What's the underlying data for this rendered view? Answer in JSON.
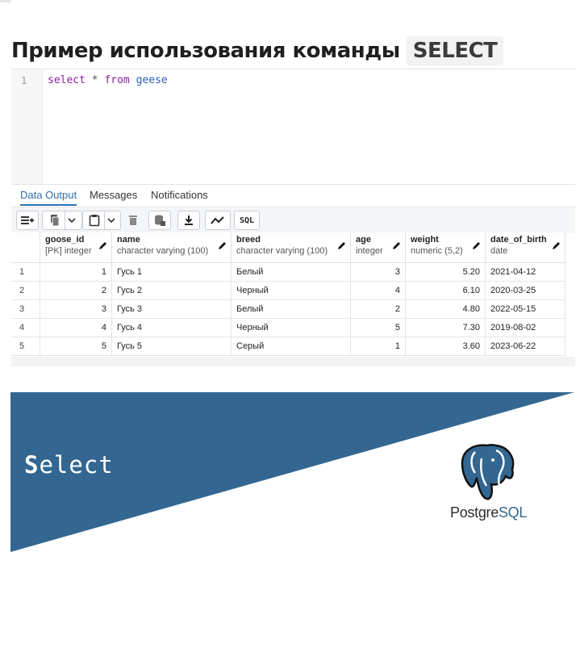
{
  "heading": {
    "text": "Пример использования команды",
    "code": "SELECT"
  },
  "editor": {
    "line_number": "1",
    "tokens": {
      "select": "select",
      "star": "*",
      "from": "from",
      "table": "geese"
    }
  },
  "tabs": [
    {
      "label": "Data Output",
      "active": true
    },
    {
      "label": "Messages",
      "active": false
    },
    {
      "label": "Notifications",
      "active": false
    }
  ],
  "toolbar": {
    "icons": [
      "add-row-icon",
      "copy-icon",
      "chevron-down-icon",
      "paste-icon",
      "chevron-down-icon",
      "delete-icon",
      "save-data-icon",
      "download-icon",
      "graph-icon",
      "sql-icon"
    ],
    "sql_label": "SQL"
  },
  "grid": {
    "columns": [
      {
        "name": "goose_id",
        "type": "[PK] integer"
      },
      {
        "name": "name",
        "type": "character varying (100)"
      },
      {
        "name": "breed",
        "type": "character varying (100)"
      },
      {
        "name": "age",
        "type": "integer"
      },
      {
        "name": "weight",
        "type": "numeric (5,2)"
      },
      {
        "name": "date_of_birth",
        "type": "date"
      }
    ],
    "rows": [
      {
        "n": "1",
        "cells": [
          "1",
          "Гусь 1",
          "Белый",
          "3",
          "5.20",
          "2021-04-12"
        ]
      },
      {
        "n": "2",
        "cells": [
          "2",
          "Гусь 2",
          "Черный",
          "4",
          "6.10",
          "2020-03-25"
        ]
      },
      {
        "n": "3",
        "cells": [
          "3",
          "Гусь 3",
          "Белый",
          "2",
          "4.80",
          "2022-05-15"
        ]
      },
      {
        "n": "4",
        "cells": [
          "4",
          "Гусь 4",
          "Черный",
          "5",
          "7.30",
          "2019-08-02"
        ]
      },
      {
        "n": "5",
        "cells": [
          "5",
          "Гусь 5",
          "Серый",
          "1",
          "3.60",
          "2023-06-22"
        ]
      }
    ]
  },
  "banner": {
    "label_first": "S",
    "label_rest": "elect",
    "logo_word_a": "Postgre",
    "logo_word_b": "SQL",
    "colors": {
      "triangle": "#336791",
      "accent": "#2f6fb3"
    }
  }
}
